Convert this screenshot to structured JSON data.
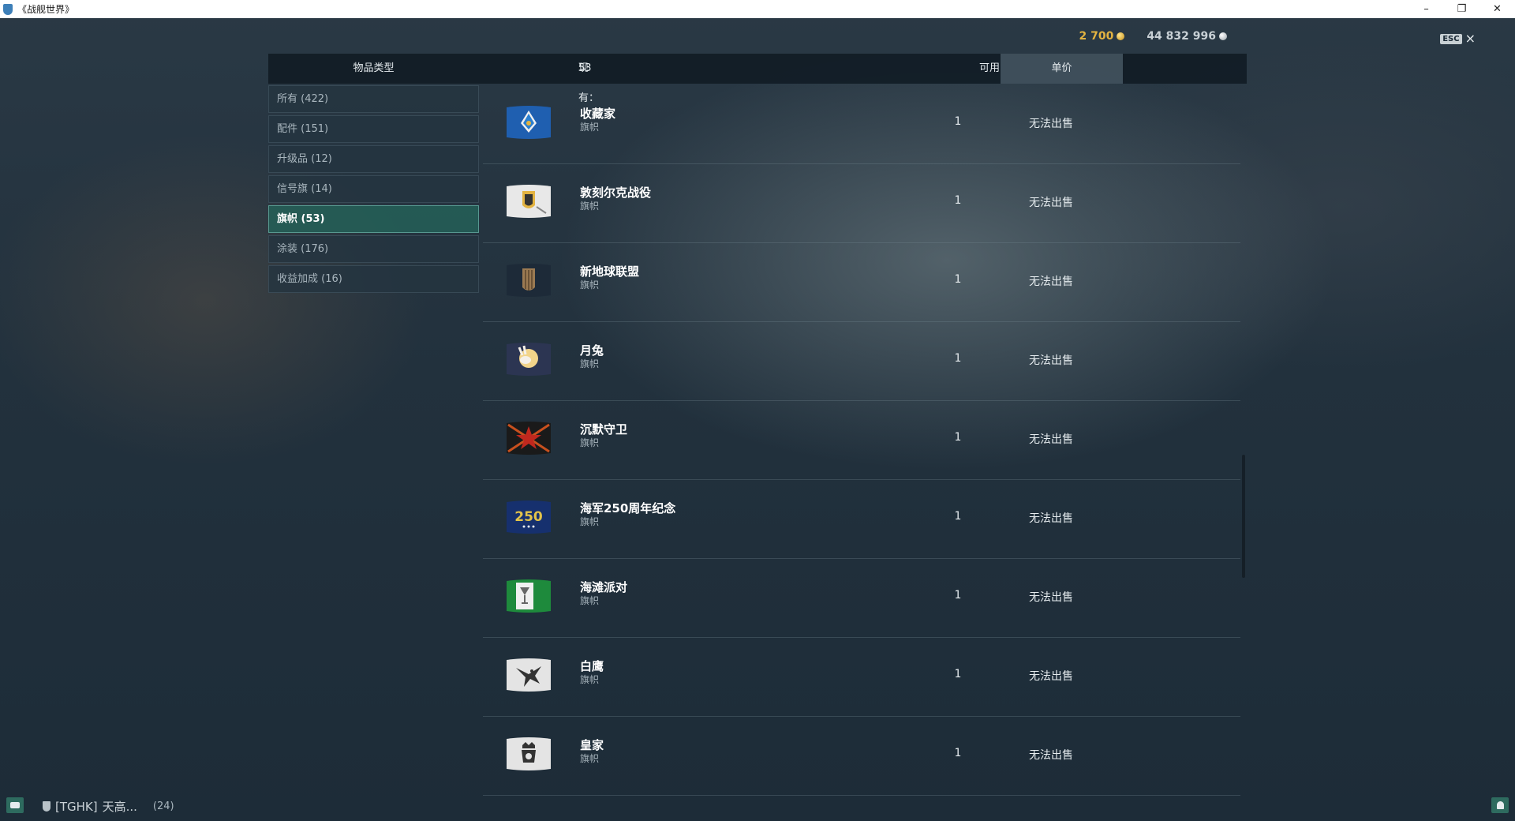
{
  "window": {
    "title": "《战舰世界》",
    "controls": {
      "minimize": "–",
      "restore": "❐",
      "close": "✕"
    }
  },
  "currency": {
    "gold": "2 700",
    "credits": "44 832 996"
  },
  "esc": {
    "key": "ESC",
    "close": "×"
  },
  "header": {
    "type": "物品类型",
    "owned_label": "现有：",
    "owned_count": "53",
    "available": "可用",
    "price": "单价"
  },
  "categories": [
    {
      "label": "所有 (422)",
      "active": false
    },
    {
      "label": "配件 (151)",
      "active": false
    },
    {
      "label": "升级品 (12)",
      "active": false
    },
    {
      "label": "信号旗 (14)",
      "active": false
    },
    {
      "label": "旗帜 (53)",
      "active": true
    },
    {
      "label": "涂装 (176)",
      "active": false
    },
    {
      "label": "收益加成 (16)",
      "active": false
    }
  ],
  "items": [
    {
      "name": "收藏家",
      "type": "旗帜",
      "qty": "1",
      "price": "无法出售",
      "icon": "collector-flag-icon"
    },
    {
      "name": "敦刻尔克战役",
      "type": "旗帜",
      "qty": "1",
      "price": "无法出售",
      "icon": "dunkirk-flag-icon"
    },
    {
      "name": "新地球联盟",
      "type": "旗帜",
      "qty": "1",
      "price": "无法出售",
      "icon": "new-earth-alliance-flag-icon"
    },
    {
      "name": "月兔",
      "type": "旗帜",
      "qty": "1",
      "price": "无法出售",
      "icon": "moon-rabbit-flag-icon"
    },
    {
      "name": "沉默守卫",
      "type": "旗帜",
      "qty": "1",
      "price": "无法出售",
      "icon": "silent-guard-flag-icon"
    },
    {
      "name": "海军250周年纪念",
      "type": "旗帜",
      "qty": "1",
      "price": "无法出售",
      "icon": "navy-250-flag-icon",
      "badge": "250"
    },
    {
      "name": "海滩派对",
      "type": "旗帜",
      "qty": "1",
      "price": "无法出售",
      "icon": "beach-party-flag-icon"
    },
    {
      "name": "白鹰",
      "type": "旗帜",
      "qty": "1",
      "price": "无法出售",
      "icon": "white-eagle-flag-icon"
    },
    {
      "name": "皇家",
      "type": "旗帜",
      "qty": "1",
      "price": "无法出售",
      "icon": "royal-flag-icon"
    }
  ],
  "bottom": {
    "clan_tag": "[TGHK]",
    "clan_name": "天高...",
    "clan_count": "(24)"
  },
  "colors": {
    "accent_active": "#246058",
    "gold": "#e3b341",
    "panel": "#111c25"
  }
}
